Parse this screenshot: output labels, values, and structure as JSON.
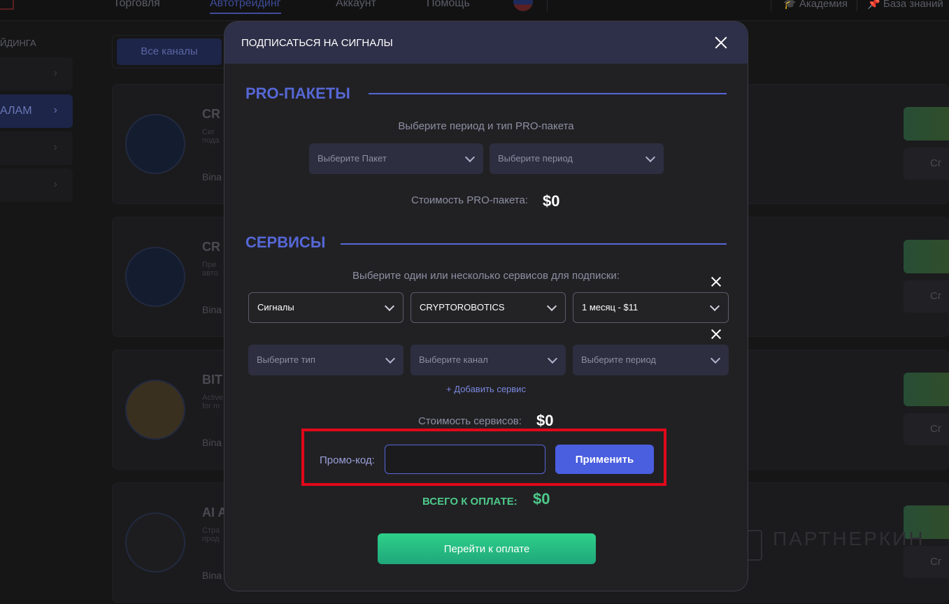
{
  "topnav": {
    "tabs": [
      "Торговля",
      "Автотрейдинг",
      "Аккаунт",
      "Помощь"
    ],
    "active_tab": "Автотрейдинг",
    "right_links": [
      "Академия",
      "База знаний"
    ]
  },
  "sidebar": {
    "title": "ЙДИНГА",
    "active_label": "АЛАМ"
  },
  "channel_tabs": {
    "all": "Все каналы"
  },
  "cards": [
    {
      "name": "CR",
      "desc_line1": "Сиг",
      "desc_line2": "пода",
      "exchange": "Bina",
      "action": "Сг"
    },
    {
      "name": "CR",
      "desc_line1": "При",
      "desc_line2": "авто",
      "exchange": "Bina",
      "action": "Сг"
    },
    {
      "name": "BIT",
      "desc_line1": "Active",
      "desc_line2": "for m",
      "exchange": "Bina",
      "action": "Сг"
    },
    {
      "name": "AI A",
      "desc_line1": "Стра",
      "desc_line2": "прод",
      "exchange": "Bina",
      "action": "Сг"
    }
  ],
  "watermark": "ПАРТНЕРКИН",
  "modal": {
    "title": "ПОДПИСАТЬСЯ НА СИГНАЛЫ",
    "pro": {
      "section_title": "PRO-ПАКЕТЫ",
      "hint": "Выберите период и тип PRO-пакета",
      "package_placeholder": "Выберите Пакет",
      "period_placeholder": "Выберите период",
      "cost_label": "Стоимость PRO-пакета:",
      "cost_value": "$0"
    },
    "services": {
      "section_title": "СЕРВИСЫ",
      "hint": "Выберите один или несколько сервисов для подписки:",
      "rows": [
        {
          "type": "Сигналы",
          "channel": "CRYPTOROBOTICS",
          "period": "1 месяц - $11"
        },
        {
          "type": "Выберите тип",
          "channel": "Выберите канал",
          "period": "Выберите период"
        }
      ],
      "add_label": "+ Добавить сервис",
      "cost_label": "Стоимость сервисов:",
      "cost_value": "$0"
    },
    "promo": {
      "label": "Промо-код:",
      "value": "",
      "apply_label": "Применить"
    },
    "total": {
      "label": "ВСЕГО К ОПЛАТЕ:",
      "value": "$0"
    },
    "pay_label": "Перейти к оплате"
  },
  "colors": {
    "accent": "#5667d6",
    "button": "#4a5ee0",
    "total": "#4ec98a",
    "highlight": "#e0081a"
  }
}
